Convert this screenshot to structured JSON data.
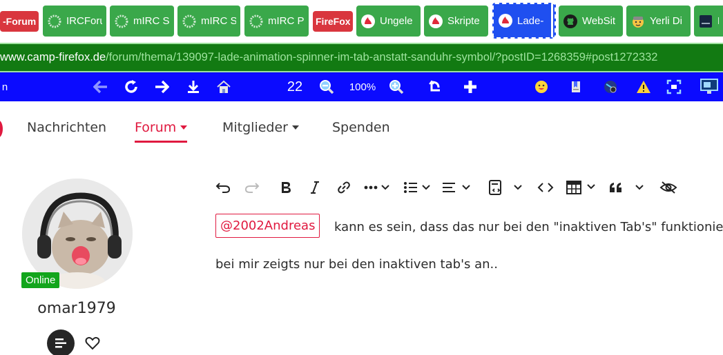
{
  "tabs": [
    {
      "label": "-Forum",
      "style": "red",
      "icon": "none"
    },
    {
      "label": "IRCForum",
      "style": "green",
      "icon": "circle-logo-icon"
    },
    {
      "label": "mIRC S",
      "style": "green",
      "icon": "circle-logo-icon"
    },
    {
      "label": "mIRC S",
      "style": "green",
      "icon": "circle-logo-icon"
    },
    {
      "label": "mIRC P",
      "style": "green",
      "icon": "circle-logo-icon"
    },
    {
      "label": "FireFox",
      "style": "red",
      "icon": "none"
    },
    {
      "label": "Ungele",
      "style": "green",
      "icon": "firefox-camp-icon"
    },
    {
      "label": "Skripte",
      "style": "green",
      "icon": "firefox-camp-icon"
    },
    {
      "label": "Lade-",
      "style": "active",
      "icon": "firefox-camp-icon"
    },
    {
      "label": "WebSit",
      "style": "green",
      "icon": "github-icon"
    },
    {
      "label": "Yerli Di",
      "style": "green",
      "icon": "emoji-icon"
    },
    {
      "label": "L",
      "style": "green",
      "icon": "app-icon"
    }
  ],
  "url": {
    "host": "www.camp-firefox.de",
    "path": "/forum/thema/139097-lade-animation-spinner-im-tab-anstatt-sanduhr-symbol/?postID=1268359#post1272332"
  },
  "toolbar": {
    "left_text": "n",
    "counter": "22",
    "zoom": "100%"
  },
  "nav": {
    "items": [
      {
        "label": "Nachrichten",
        "has_caret": false,
        "active": false
      },
      {
        "label": "Forum",
        "has_caret": true,
        "active": true
      },
      {
        "label": "Mitglieder",
        "has_caret": true,
        "active": false
      },
      {
        "label": "Spenden",
        "has_caret": false,
        "active": false
      }
    ]
  },
  "user": {
    "status": "Online",
    "name": "omar1979"
  },
  "post": {
    "mention": "@2002Andreas",
    "line1": "kann es sein, dass das nur bei den \"inaktiven Tab's\" funktioniert?",
    "line2": "bei mir zeigts nur bei den inaktiven tab's an.."
  },
  "colors": {
    "accent": "#e0193f",
    "tab_green": "#3aa84a",
    "tab_red": "#d9363e",
    "tab_active": "#1f4ff0",
    "urlbar": "#127a12",
    "toolbar_blue": "#0b0bff",
    "online": "#12a51c"
  }
}
